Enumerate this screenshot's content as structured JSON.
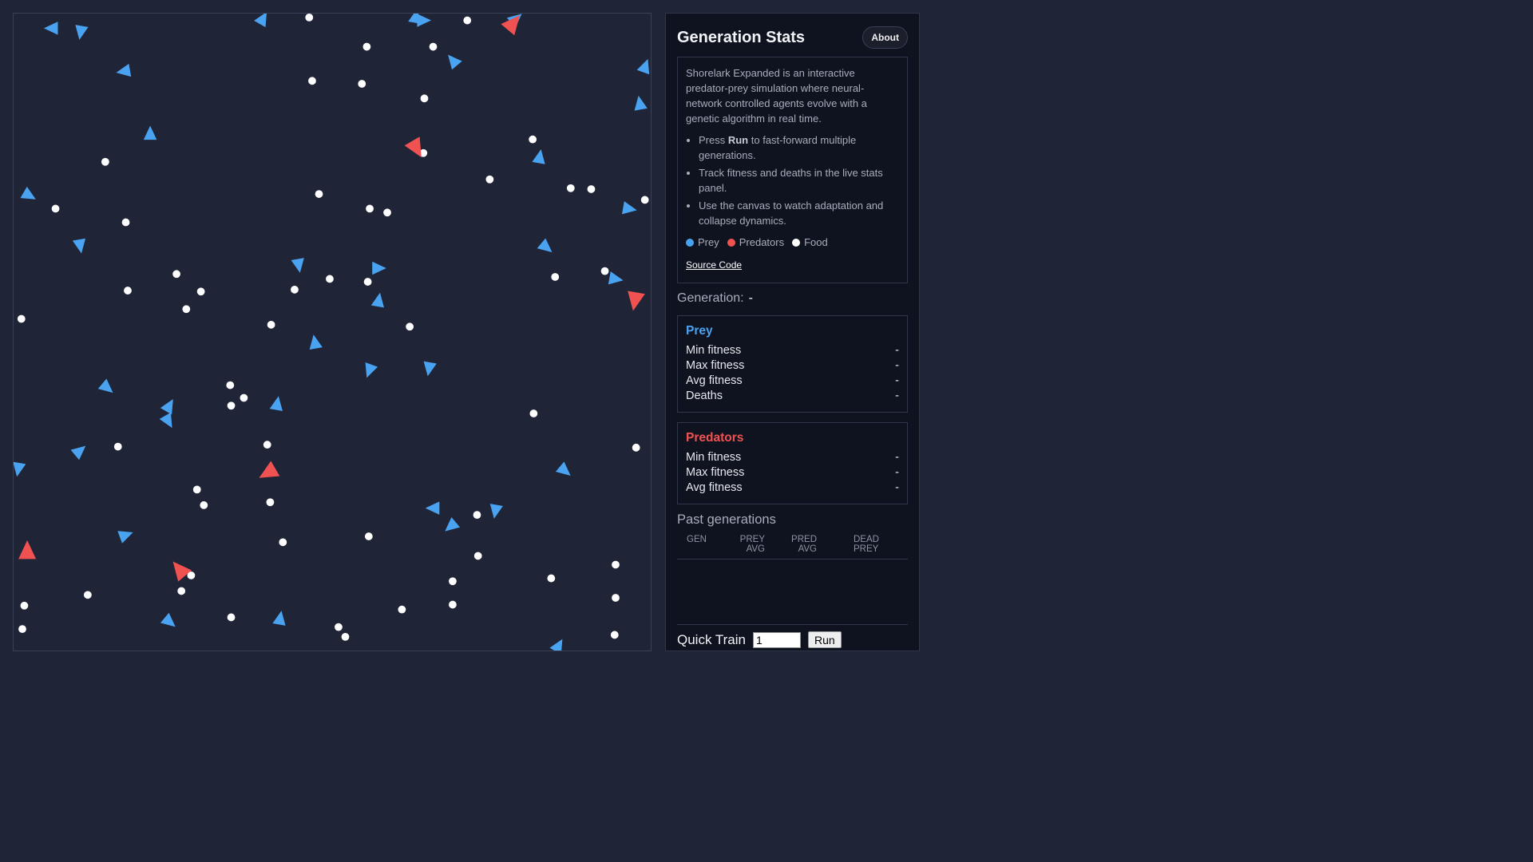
{
  "panel": {
    "title": "Generation Stats",
    "about_label": "About",
    "description": "Shorelark Expanded is an interactive predator-prey simulation where neural-network controlled agents evolve with a genetic algorithm in real time.",
    "bullets": [
      {
        "pre": "Press ",
        "bold": "Run",
        "post": " to fast-forward multiple generations."
      },
      {
        "text": "Track fitness and deaths in the live stats panel."
      },
      {
        "text": "Use the canvas to watch adaptation and collapse dynamics."
      }
    ],
    "legend": [
      {
        "label": "Prey",
        "color": "#4aa3f0"
      },
      {
        "label": "Predators",
        "color": "#f05252"
      },
      {
        "label": "Food",
        "color": "#ffffff"
      }
    ],
    "source_link": "Source Code",
    "generation_label": "Generation:",
    "generation_value": "-",
    "prey": {
      "title": "Prey",
      "rows": [
        {
          "label": "Min fitness",
          "value": "-"
        },
        {
          "label": "Max fitness",
          "value": "-"
        },
        {
          "label": "Avg fitness",
          "value": "-"
        },
        {
          "label": "Deaths",
          "value": "-"
        }
      ]
    },
    "predators": {
      "title": "Predators",
      "rows": [
        {
          "label": "Min fitness",
          "value": "-"
        },
        {
          "label": "Max fitness",
          "value": "-"
        },
        {
          "label": "Avg fitness",
          "value": "-"
        }
      ]
    },
    "past_title": "Past generations",
    "columns": [
      [
        "GEN",
        ""
      ],
      [
        "PREY",
        "AVG"
      ],
      [
        "PRED",
        "AVG"
      ],
      [
        "DEAD",
        "PREY"
      ]
    ],
    "quick_train_label": "Quick Train",
    "quick_train_value": "1",
    "run_label": "Run"
  },
  "colors": {
    "prey": "#4aa3f0",
    "predator": "#f05252",
    "food": "#ffffff"
  }
}
